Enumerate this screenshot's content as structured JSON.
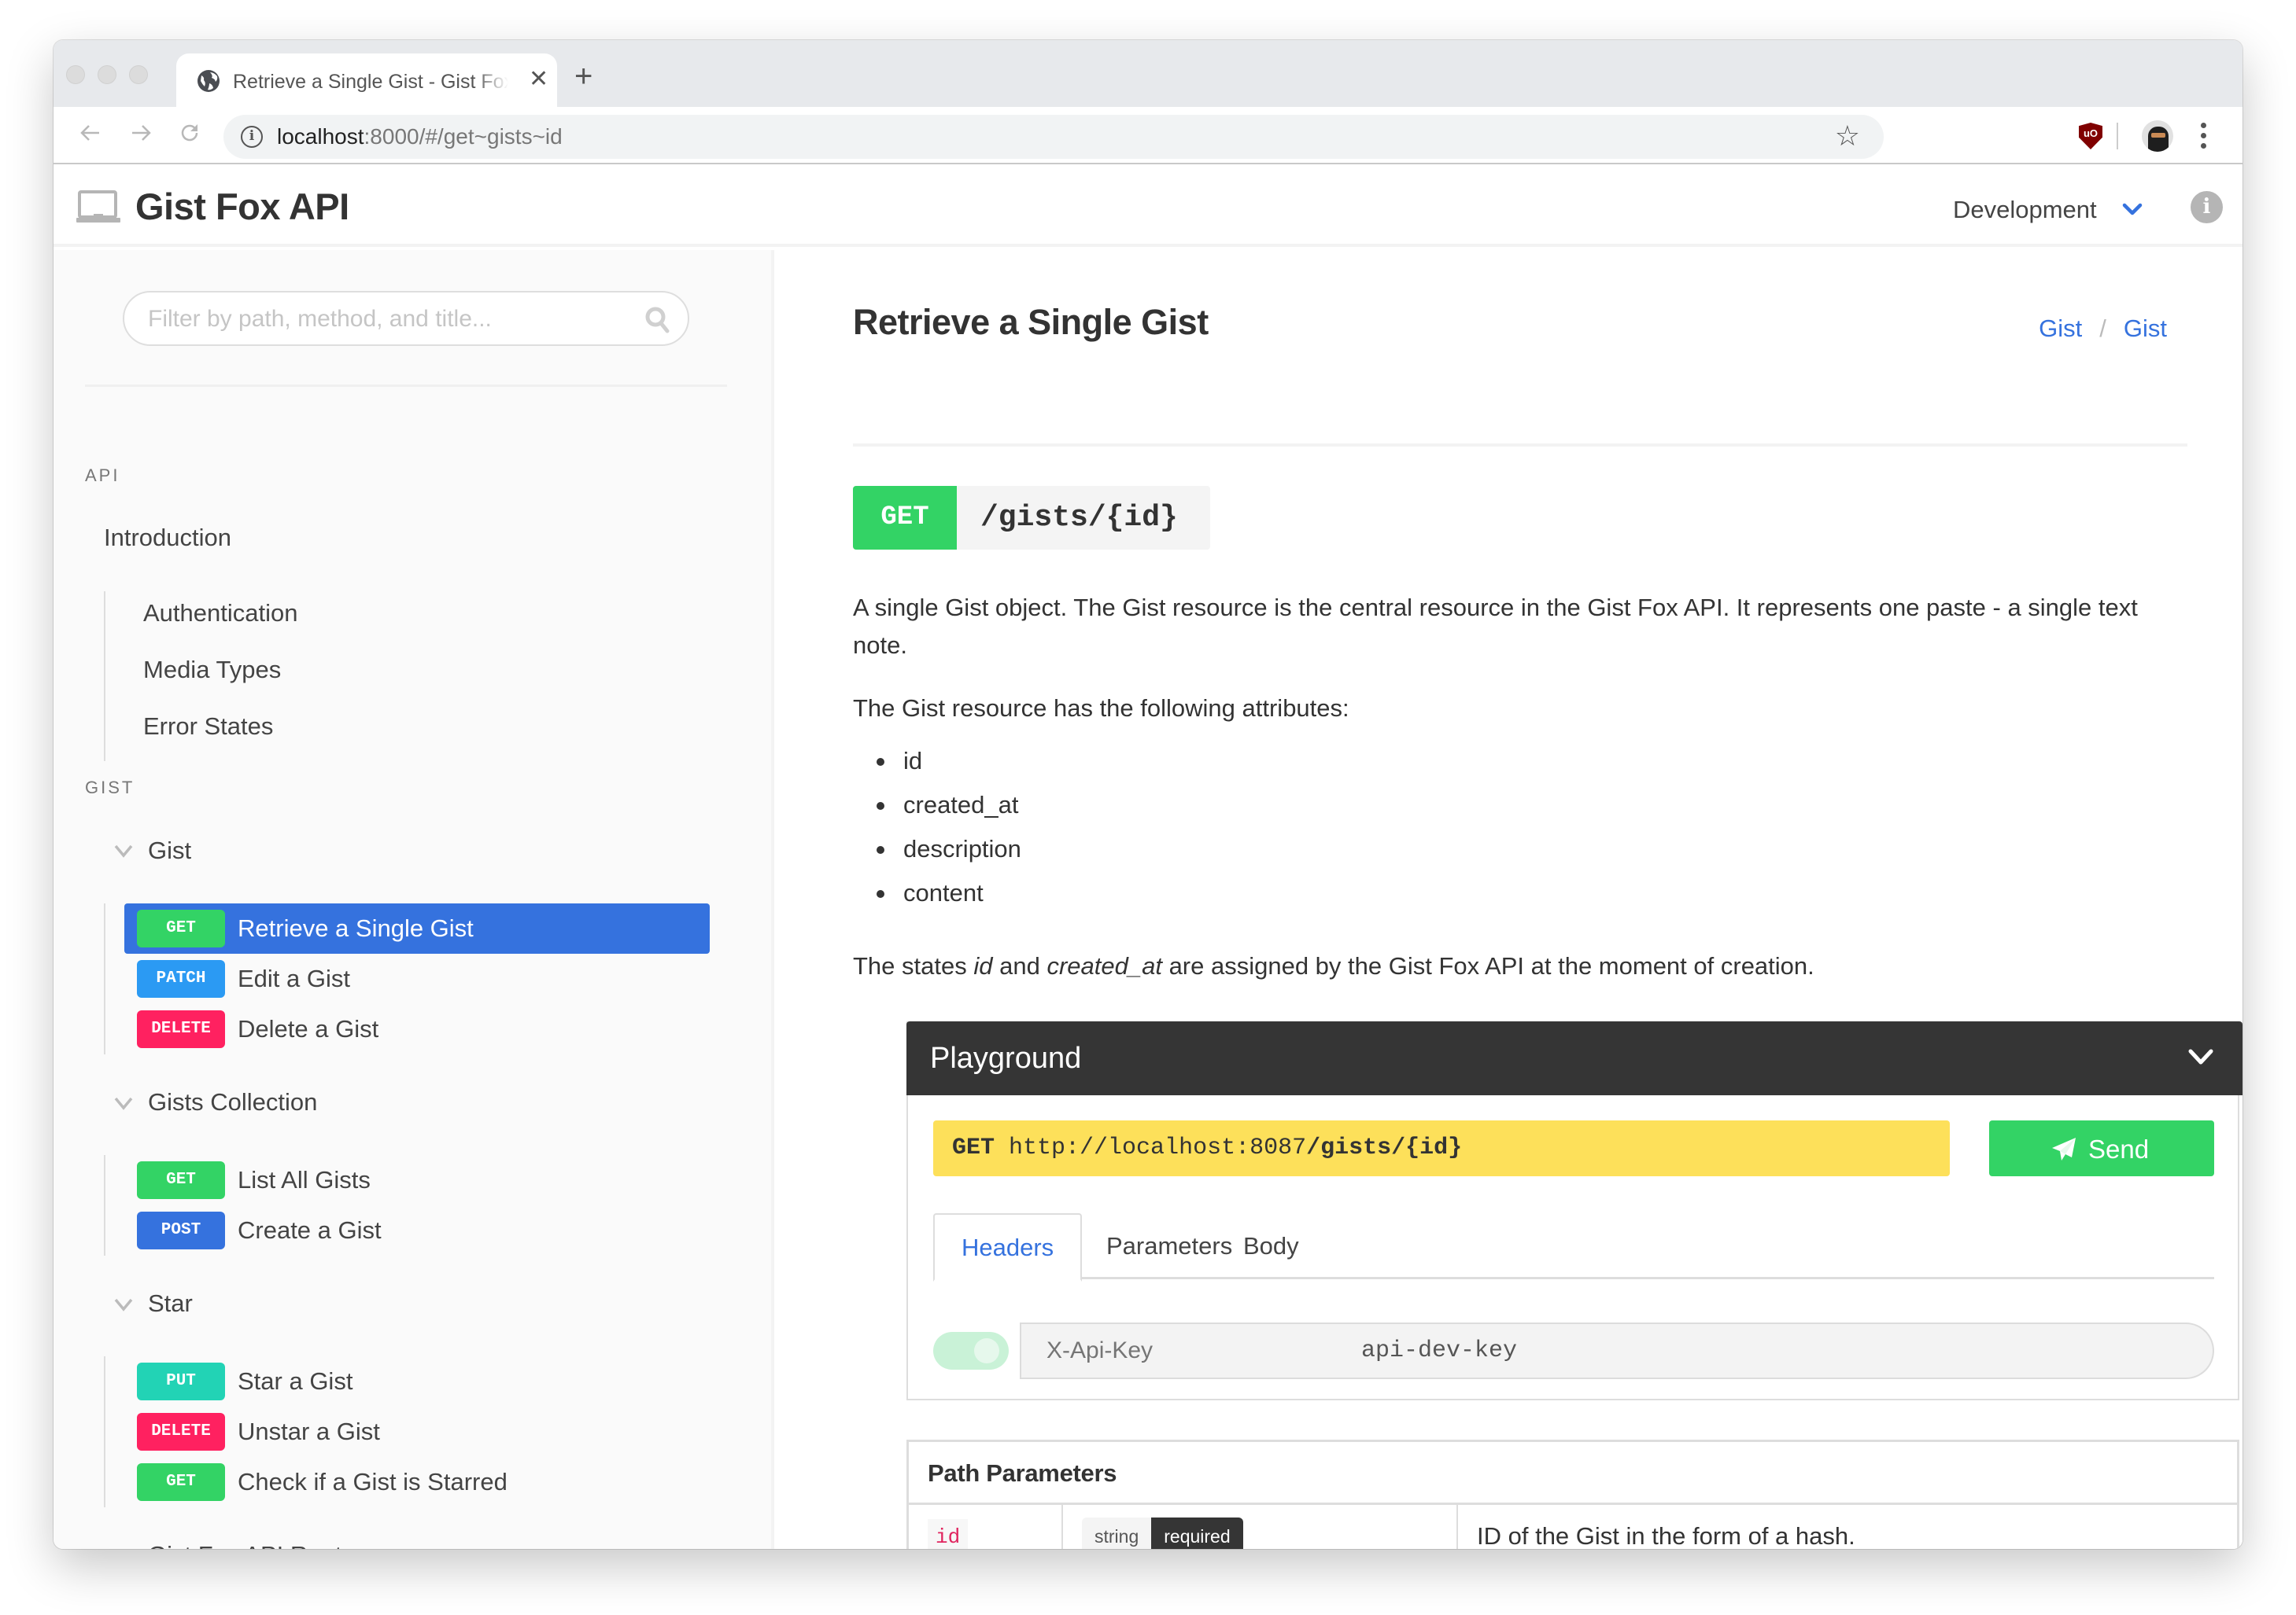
{
  "browser": {
    "tab_title": "Retrieve a Single Gist - Gist Fox API",
    "url_host": "localhost",
    "url_rest": ":8000/#/get~gists~id",
    "new_tab_label": "+",
    "close_tab_label": "✕"
  },
  "header": {
    "app_title": "Gist Fox API",
    "environment": "Development",
    "info_label": "i"
  },
  "sidebar": {
    "search_placeholder": "Filter by path, method, and title...",
    "sections": [
      {
        "label": "API",
        "items": [
          {
            "label": "Introduction"
          },
          {
            "label": "Authentication"
          },
          {
            "label": "Media Types"
          },
          {
            "label": "Error States"
          }
        ]
      },
      {
        "label": "GIST",
        "groups": [
          {
            "label": "Gist",
            "endpoints": [
              {
                "method": "GET",
                "label": "Retrieve a Single Gist",
                "active": true
              },
              {
                "method": "PATCH",
                "label": "Edit a Gist"
              },
              {
                "method": "DELETE",
                "label": "Delete a Gist"
              }
            ]
          },
          {
            "label": "Gists Collection",
            "endpoints": [
              {
                "method": "GET",
                "label": "List All Gists"
              },
              {
                "method": "POST",
                "label": "Create a Gist"
              }
            ]
          },
          {
            "label": "Star",
            "endpoints": [
              {
                "method": "PUT",
                "label": "Star a Gist"
              },
              {
                "method": "DELETE",
                "label": "Unstar a Gist"
              },
              {
                "method": "GET",
                "label": "Check if a Gist is Starred"
              }
            ]
          },
          {
            "label": "Gist Fox API Root",
            "endpoints": []
          }
        ]
      }
    ]
  },
  "method_colors": {
    "GET": "#33d365",
    "PATCH": "#2b9af3",
    "DELETE": "#ff2160",
    "POST": "#3572de",
    "PUT": "#22d3b5"
  },
  "main": {
    "title": "Retrieve a Single Gist",
    "breadcrumb": [
      "Gist",
      "Gist"
    ],
    "breadcrumb_separator": "/",
    "method": "GET",
    "path": "/gists/{id}",
    "description": "A single Gist object. The Gist resource is the central resource in the Gist Fox API. It represents one paste - a single text note.",
    "attributes_intro": "The Gist resource has the following attributes:",
    "attributes": [
      "id",
      "created_at",
      "description",
      "content"
    ],
    "states_note": {
      "prefix": "The states ",
      "em1": "id",
      "mid": " and ",
      "em2": "created_at",
      "suffix": " are assigned by the Gist Fox API at the moment of creation."
    }
  },
  "playground": {
    "title": "Playground",
    "request_method": "GET",
    "request_base": "http://localhost:8087",
    "request_path": "/gists/{id}",
    "send_label": "Send",
    "tabs": [
      {
        "label": "Headers",
        "active": true
      },
      {
        "label": "Parameters"
      },
      {
        "label": "Body"
      }
    ],
    "header_row": {
      "enabled": true,
      "key_placeholder": "X-Api-Key",
      "value": "api-dev-key"
    }
  },
  "path_parameters": {
    "title": "Path Parameters",
    "rows": [
      {
        "name": "id",
        "type": "string",
        "required_label": "required",
        "description": "ID of the Gist in the form of a hash."
      }
    ]
  },
  "colors": {
    "accent": "#3572de",
    "playground_header": "#353535",
    "request_bar": "#fde05a",
    "send_button": "#33d365"
  }
}
